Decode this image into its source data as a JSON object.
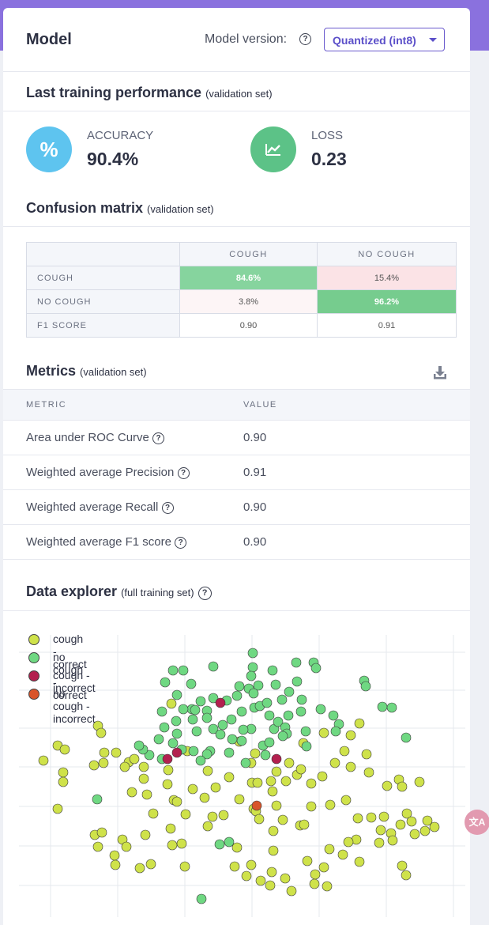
{
  "header": {
    "title": "Model",
    "version_label": "Model version:",
    "version_value": "Quantized (int8)"
  },
  "performance": {
    "title": "Last training performance",
    "subtitle": "(validation set)",
    "accuracy_label": "ACCURACY",
    "accuracy_value": "90.4%",
    "accuracy_icon_text": "%",
    "loss_label": "LOSS",
    "loss_value": "0.23"
  },
  "confusion": {
    "title": "Confusion matrix",
    "subtitle": "(validation set)",
    "columns": [
      "COUGH",
      "NO COUGH"
    ],
    "rows": [
      {
        "label": "COUGH",
        "cells": [
          "84.6%",
          "15.4%"
        ],
        "colors": [
          "#86d49e",
          "#fbe3e6"
        ]
      },
      {
        "label": "NO COUGH",
        "cells": [
          "3.8%",
          "96.2%"
        ],
        "colors": [
          "#fdf5f6",
          "#76cc8e"
        ]
      },
      {
        "label": "F1 SCORE",
        "cells": [
          "0.90",
          "0.91"
        ],
        "colors": [
          "#ffffff",
          "#ffffff"
        ]
      }
    ]
  },
  "metrics": {
    "title": "Metrics",
    "subtitle": "(validation set)",
    "col_metric": "METRIC",
    "col_value": "VALUE",
    "rows": [
      {
        "name": "Area under ROC Curve",
        "value": "0.90"
      },
      {
        "name": "Weighted average Precision",
        "value": "0.91"
      },
      {
        "name": "Weighted average Recall",
        "value": "0.90"
      },
      {
        "name": "Weighted average F1 score",
        "value": "0.90"
      }
    ]
  },
  "explorer": {
    "title": "Data explorer",
    "subtitle": "(full training set)",
    "legend": [
      {
        "label": "cough - correct",
        "color": "#cfe24a"
      },
      {
        "label": "no cough - correct",
        "color": "#6fd882"
      },
      {
        "label": "cough - incorrect",
        "color": "#b3204f"
      },
      {
        "label": "no cough - incorrect",
        "color": "#d8542a"
      }
    ]
  },
  "chart_data": {
    "type": "scatter",
    "series": [
      {
        "name": "cough - correct",
        "points": [
          [
            55,
            952
          ],
          [
            73,
            933
          ],
          [
            82,
            938
          ],
          [
            80,
            967
          ],
          [
            80,
            979
          ],
          [
            73,
            1013
          ],
          [
            124,
            908
          ],
          [
            128,
            917
          ],
          [
            119,
            958
          ],
          [
            132,
            942
          ],
          [
            147,
            942
          ],
          [
            131,
            955
          ],
          [
            163,
            954
          ],
          [
            158,
            960
          ],
          [
            170,
            950
          ],
          [
            182,
            960
          ],
          [
            182,
            975
          ],
          [
            167,
            992
          ],
          [
            186,
            995
          ],
          [
            213,
            964
          ],
          [
            212,
            982
          ],
          [
            220,
            1002
          ],
          [
            244,
            988
          ],
          [
            259,
            999
          ],
          [
            263,
            965
          ],
          [
            273,
            986
          ],
          [
            290,
            973
          ],
          [
            303,
            1001
          ],
          [
            319,
            980
          ],
          [
            321,
            1013
          ],
          [
            326,
            980
          ],
          [
            343,
            978
          ],
          [
            345,
            991
          ],
          [
            350,
            1009
          ],
          [
            358,
            1027
          ],
          [
            394,
            1010
          ],
          [
            418,
            1008
          ],
          [
            438,
            1002
          ],
          [
            444,
            960
          ],
          [
            467,
            967
          ],
          [
            490,
            984
          ],
          [
            505,
            976
          ],
          [
            509,
            985
          ],
          [
            515,
            1019
          ],
          [
            531,
            979
          ],
          [
            541,
            1028
          ],
          [
            550,
            1036
          ],
          [
            521,
            1029
          ],
          [
            525,
            1045
          ],
          [
            507,
            1033
          ],
          [
            486,
            1023
          ],
          [
            470,
            1024
          ],
          [
            453,
            1025
          ],
          [
            451,
            1052
          ],
          [
            482,
            1040
          ],
          [
            495,
            1044
          ],
          [
            497,
            1053
          ],
          [
            538,
            1041
          ],
          [
            509,
            1085
          ],
          [
            514,
            1097
          ],
          [
            480,
            1056
          ],
          [
            441,
            1055
          ],
          [
            434,
            1071
          ],
          [
            417,
            1064
          ],
          [
            410,
            1087
          ],
          [
            399,
            1096
          ],
          [
            389,
            1079
          ],
          [
            380,
            1034
          ],
          [
            369,
            1117
          ],
          [
            361,
            1101
          ],
          [
            344,
            1093
          ],
          [
            346,
            1066
          ],
          [
            346,
            1041
          ],
          [
            330,
            1104
          ],
          [
            312,
            1098
          ],
          [
            318,
            1084
          ],
          [
            297,
            1086
          ],
          [
            300,
            1062
          ],
          [
            263,
            1035
          ],
          [
            269,
            1023
          ],
          [
            283,
            1021
          ],
          [
            235,
            1020
          ],
          [
            230,
            1057
          ],
          [
            218,
            1059
          ],
          [
            216,
            1038
          ],
          [
            224,
            1004
          ],
          [
            194,
            1019
          ],
          [
            184,
            1046
          ],
          [
            155,
            1052
          ],
          [
            160,
            1061
          ],
          [
            145,
            1072
          ],
          [
            146,
            1084
          ],
          [
            177,
            1088
          ],
          [
            191,
            1083
          ],
          [
            234,
            1086
          ],
          [
            124,
            1061
          ],
          [
            120,
            1046
          ],
          [
            129,
            1043
          ],
          [
            324,
            1016
          ],
          [
            328,
            1026
          ],
          [
            217,
            880
          ],
          [
            237,
            940
          ],
          [
            303,
            928
          ],
          [
            318,
            955
          ],
          [
            323,
            943
          ],
          [
            350,
            966
          ],
          [
            366,
            955
          ],
          [
            362,
            978
          ],
          [
            376,
            970
          ],
          [
            381,
            963
          ],
          [
            384,
            930
          ],
          [
            394,
            981
          ],
          [
            408,
            972
          ],
          [
            410,
            917
          ],
          [
            424,
            955
          ],
          [
            436,
            940
          ],
          [
            444,
            920
          ],
          [
            464,
            944
          ],
          [
            455,
            905
          ],
          [
            342,
            1110
          ],
          [
            385,
            1033
          ],
          [
            398,
            1108
          ],
          [
            414,
            1111
          ],
          [
            455,
            1080
          ]
        ]
      },
      {
        "name": "no cough - correct",
        "points": [
          [
            219,
            838
          ],
          [
            232,
            838
          ],
          [
            242,
            855
          ],
          [
            270,
            833
          ],
          [
            320,
            816
          ],
          [
            320,
            834
          ],
          [
            318,
            845
          ],
          [
            345,
            838
          ],
          [
            375,
            828
          ],
          [
            397,
            828
          ],
          [
            400,
            835
          ],
          [
            376,
            852
          ],
          [
            349,
            856
          ],
          [
            327,
            857
          ],
          [
            315,
            861
          ],
          [
            303,
            858
          ],
          [
            321,
            867
          ],
          [
            300,
            870
          ],
          [
            287,
            876
          ],
          [
            270,
            873
          ],
          [
            254,
            877
          ],
          [
            262,
            889
          ],
          [
            243,
            887
          ],
          [
            232,
            887
          ],
          [
            224,
            869
          ],
          [
            209,
            853
          ],
          [
            205,
            890
          ],
          [
            208,
            910
          ],
          [
            223,
            902
          ],
          [
            224,
            918
          ],
          [
            244,
            900
          ],
          [
            249,
            915
          ],
          [
            262,
            898
          ],
          [
            270,
            912
          ],
          [
            282,
            907
          ],
          [
            293,
            900
          ],
          [
            306,
            890
          ],
          [
            322,
            885
          ],
          [
            329,
            883
          ],
          [
            341,
            895
          ],
          [
            347,
            912
          ],
          [
            352,
            903
          ],
          [
            365,
            895
          ],
          [
            361,
            910
          ],
          [
            363,
            918
          ],
          [
            381,
            890
          ],
          [
            382,
            875
          ],
          [
            366,
            865
          ],
          [
            357,
            875
          ],
          [
            338,
            879
          ],
          [
            318,
            912
          ],
          [
            308,
            913
          ],
          [
            306,
            927
          ],
          [
            294,
            925
          ],
          [
            279,
            919
          ],
          [
            290,
            942
          ],
          [
            266,
            940
          ],
          [
            262,
            944
          ],
          [
            254,
            952
          ],
          [
            245,
            940
          ],
          [
            230,
            938
          ],
          [
            219,
            930
          ],
          [
            201,
            925
          ],
          [
            205,
            950
          ],
          [
            189,
            945
          ],
          [
            181,
            938
          ],
          [
            176,
            933
          ],
          [
            247,
            888
          ],
          [
            311,
            955
          ],
          [
            333,
            933
          ],
          [
            336,
            945
          ],
          [
            341,
            929
          ],
          [
            358,
            921
          ],
          [
            387,
            915
          ],
          [
            388,
            934
          ],
          [
            406,
            887
          ],
          [
            422,
            895
          ],
          [
            429,
            906
          ],
          [
            425,
            915
          ],
          [
            461,
            851
          ],
          [
            463,
            858
          ],
          [
            484,
            884
          ],
          [
            496,
            885
          ],
          [
            514,
            923
          ],
          [
            123,
            1001
          ],
          [
            290,
            1055
          ],
          [
            278,
            1058
          ],
          [
            255,
            1127
          ]
        ]
      },
      {
        "name": "cough - incorrect",
        "points": [
          [
            279,
            879
          ],
          [
            212,
            950
          ],
          [
            224,
            942
          ],
          [
            350,
            950
          ]
        ]
      },
      {
        "name": "no cough - incorrect",
        "points": [
          [
            325,
            1009
          ]
        ]
      }
    ]
  }
}
